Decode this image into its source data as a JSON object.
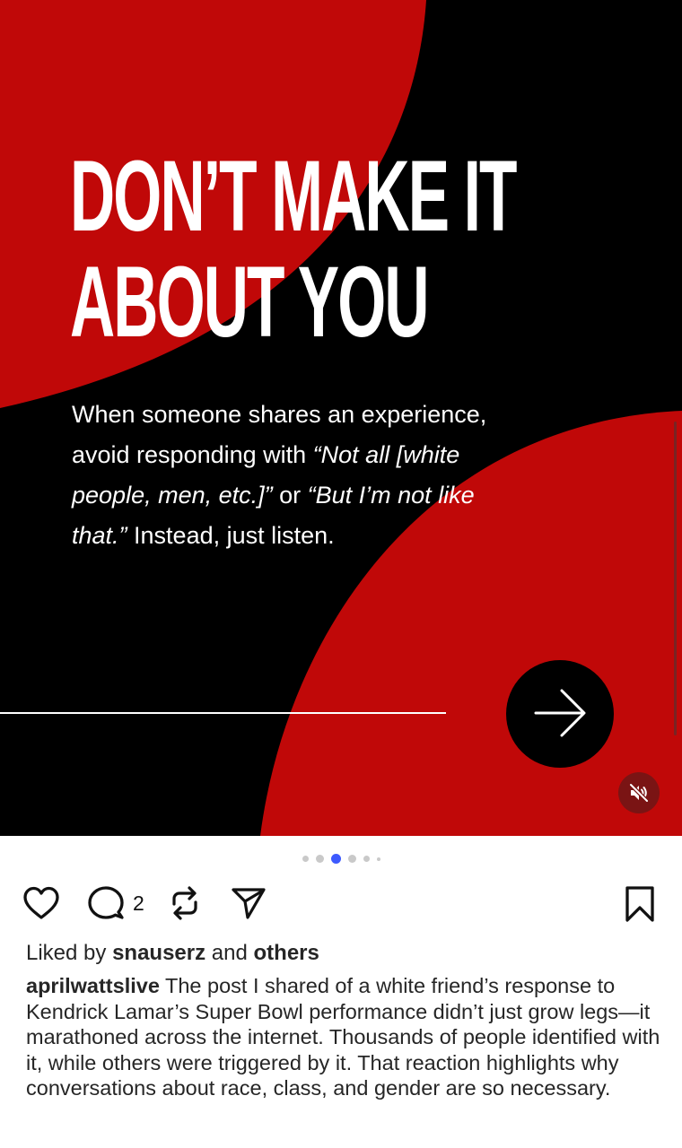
{
  "post": {
    "headline_line1": "DON’T MAKE IT",
    "headline_line2": "ABOUT YOU",
    "body_part1": "When someone shares an experience, avoid responding with ",
    "body_quote1": "“Not all [white people, men, etc.]”",
    "body_part2": " or ",
    "body_quote2": "“But I’m not like that.”",
    "body_part3": " Instead, just listen.",
    "colors": {
      "red": "#c00808",
      "black": "#000000"
    },
    "next_icon": "arrow-right-icon",
    "mute_icon": "speaker-muted-icon"
  },
  "carousel": {
    "total_dots": 6,
    "active_index": 2
  },
  "actions": {
    "like_icon": "heart-icon",
    "comment_icon": "comment-icon",
    "comment_count": "2",
    "repost_icon": "repost-icon",
    "share_icon": "send-icon",
    "save_icon": "bookmark-icon"
  },
  "likes": {
    "prefix": "Liked by ",
    "user": "snauserz",
    "middle": " and ",
    "others": "others"
  },
  "caption": {
    "username": "aprilwattslive",
    "text": " The post I shared of a white friend’s response to Kendrick Lamar’s Super Bowl performance didn’t just grow legs—it marathoned across the internet. Thousands of people identified with it, while others were triggered by it. That reaction highlights why conversations about race, class, and gender are so necessary."
  }
}
